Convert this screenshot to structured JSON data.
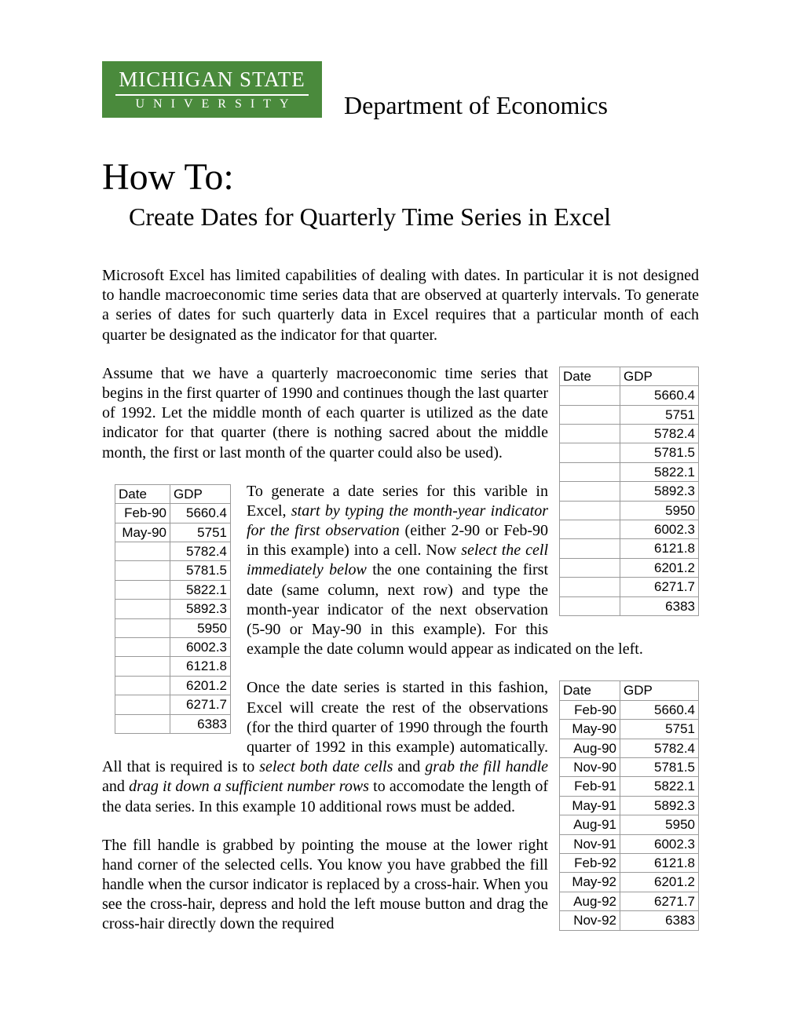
{
  "logo": {
    "top": "MICHIGAN STATE",
    "bottom": "UNIVERSITY"
  },
  "dept": "Department of Economics",
  "title": {
    "main": "How To:",
    "sub": "Create Dates for Quarterly Time Series in Excel"
  },
  "paragraphs": {
    "p1": "Microsoft Excel has limited capabilities of dealing with dates.  In particular it is not designed to handle macroeconomic time series data that are observed at quarterly intervals.  To generate a series of dates for such quarterly data in Excel requires that a particular month of each quarter be designated as the indicator for that quarter.",
    "p2": "Assume that we have a quarterly macroeconomic time series that begins in the first quarter of 1990 and continues though the last quarter of 1992. Let the middle month of each quarter is utilized as the date indicator for that quarter (there is nothing sacred about the middle month, the first or last month of the quarter could also be used).",
    "p3a": "To generate a date series for this varible in Excel, ",
    "p3i1": "start by typing the month-year indicator for the first observation",
    "p3b": " (either 2-90 or Feb-90 in this example) into a cell. Now ",
    "p3i2": "select the cell immediately below",
    "p3c": " the one containing the first date (same column, next row) and type the month-year indicator of the next observation (5-90 or May-90 in this example). For this example the date column would appear as indicated on the left.",
    "p4a": "Once the date series is started in this fashion, Excel will create the rest of the observations (for the third quarter of 1990 through the fourth quarter of 1992 in this example) automatically. All that is required is to ",
    "p4i1": "select both date cells",
    "p4b": " and ",
    "p4i2": "grab the fill handle",
    "p4c": " and ",
    "p4i3": "drag it down a sufficient number rows",
    "p4d": " to accomodate the length of the data series.  In this example 10 additional rows must be added.",
    "p5": "The fill handle is grabbed by pointing the mouse at the lower right hand corner of the selected cells.  You know you have grabbed the fill handle when the cursor indicator is replaced by a cross-hair.  When you see the cross-hair, depress and hold the left mouse button and drag the cross-hair directly down the required"
  },
  "chart_data": [
    {
      "type": "table",
      "name": "table-right-1",
      "columns": [
        "Date",
        "GDP"
      ],
      "rows": [
        {
          "date": "",
          "gdp": "5660.4"
        },
        {
          "date": "",
          "gdp": "5751"
        },
        {
          "date": "",
          "gdp": "5782.4"
        },
        {
          "date": "",
          "gdp": "5781.5"
        },
        {
          "date": "",
          "gdp": "5822.1"
        },
        {
          "date": "",
          "gdp": "5892.3"
        },
        {
          "date": "",
          "gdp": "5950"
        },
        {
          "date": "",
          "gdp": "6002.3"
        },
        {
          "date": "",
          "gdp": "6121.8"
        },
        {
          "date": "",
          "gdp": "6201.2"
        },
        {
          "date": "",
          "gdp": "6271.7"
        },
        {
          "date": "",
          "gdp": "6383"
        }
      ]
    },
    {
      "type": "table",
      "name": "table-left-1",
      "columns": [
        "Date",
        "GDP"
      ],
      "rows": [
        {
          "date": "Feb-90",
          "gdp": "5660.4"
        },
        {
          "date": "May-90",
          "gdp": "5751"
        },
        {
          "date": "",
          "gdp": "5782.4"
        },
        {
          "date": "",
          "gdp": "5781.5"
        },
        {
          "date": "",
          "gdp": "5822.1"
        },
        {
          "date": "",
          "gdp": "5892.3"
        },
        {
          "date": "",
          "gdp": "5950"
        },
        {
          "date": "",
          "gdp": "6002.3"
        },
        {
          "date": "",
          "gdp": "6121.8"
        },
        {
          "date": "",
          "gdp": "6201.2"
        },
        {
          "date": "",
          "gdp": "6271.7"
        },
        {
          "date": "",
          "gdp": "6383"
        }
      ]
    },
    {
      "type": "table",
      "name": "table-right-2",
      "columns": [
        "Date",
        "GDP"
      ],
      "rows": [
        {
          "date": "Feb-90",
          "gdp": "5660.4"
        },
        {
          "date": "May-90",
          "gdp": "5751"
        },
        {
          "date": "Aug-90",
          "gdp": "5782.4"
        },
        {
          "date": "Nov-90",
          "gdp": "5781.5"
        },
        {
          "date": "Feb-91",
          "gdp": "5822.1"
        },
        {
          "date": "May-91",
          "gdp": "5892.3"
        },
        {
          "date": "Aug-91",
          "gdp": "5950"
        },
        {
          "date": "Nov-91",
          "gdp": "6002.3"
        },
        {
          "date": "Feb-92",
          "gdp": "6121.8"
        },
        {
          "date": "May-92",
          "gdp": "6201.2"
        },
        {
          "date": "Aug-92",
          "gdp": "6271.7"
        },
        {
          "date": "Nov-92",
          "gdp": "6383"
        }
      ]
    }
  ]
}
